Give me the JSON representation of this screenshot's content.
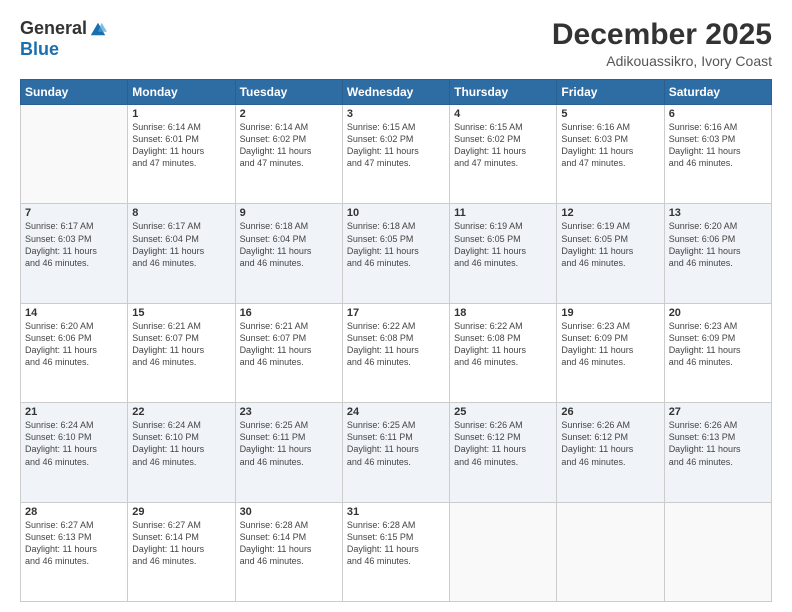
{
  "logo": {
    "general": "General",
    "blue": "Blue"
  },
  "header": {
    "month": "December 2025",
    "location": "Adikouassikro, Ivory Coast"
  },
  "weekdays": [
    "Sunday",
    "Monday",
    "Tuesday",
    "Wednesday",
    "Thursday",
    "Friday",
    "Saturday"
  ],
  "weeks": [
    [
      {
        "day": "",
        "info": ""
      },
      {
        "day": "1",
        "info": "Sunrise: 6:14 AM\nSunset: 6:01 PM\nDaylight: 11 hours\nand 47 minutes."
      },
      {
        "day": "2",
        "info": "Sunrise: 6:14 AM\nSunset: 6:02 PM\nDaylight: 11 hours\nand 47 minutes."
      },
      {
        "day": "3",
        "info": "Sunrise: 6:15 AM\nSunset: 6:02 PM\nDaylight: 11 hours\nand 47 minutes."
      },
      {
        "day": "4",
        "info": "Sunrise: 6:15 AM\nSunset: 6:02 PM\nDaylight: 11 hours\nand 47 minutes."
      },
      {
        "day": "5",
        "info": "Sunrise: 6:16 AM\nSunset: 6:03 PM\nDaylight: 11 hours\nand 47 minutes."
      },
      {
        "day": "6",
        "info": "Sunrise: 6:16 AM\nSunset: 6:03 PM\nDaylight: 11 hours\nand 46 minutes."
      }
    ],
    [
      {
        "day": "7",
        "info": "Sunrise: 6:17 AM\nSunset: 6:03 PM\nDaylight: 11 hours\nand 46 minutes."
      },
      {
        "day": "8",
        "info": "Sunrise: 6:17 AM\nSunset: 6:04 PM\nDaylight: 11 hours\nand 46 minutes."
      },
      {
        "day": "9",
        "info": "Sunrise: 6:18 AM\nSunset: 6:04 PM\nDaylight: 11 hours\nand 46 minutes."
      },
      {
        "day": "10",
        "info": "Sunrise: 6:18 AM\nSunset: 6:05 PM\nDaylight: 11 hours\nand 46 minutes."
      },
      {
        "day": "11",
        "info": "Sunrise: 6:19 AM\nSunset: 6:05 PM\nDaylight: 11 hours\nand 46 minutes."
      },
      {
        "day": "12",
        "info": "Sunrise: 6:19 AM\nSunset: 6:05 PM\nDaylight: 11 hours\nand 46 minutes."
      },
      {
        "day": "13",
        "info": "Sunrise: 6:20 AM\nSunset: 6:06 PM\nDaylight: 11 hours\nand 46 minutes."
      }
    ],
    [
      {
        "day": "14",
        "info": "Sunrise: 6:20 AM\nSunset: 6:06 PM\nDaylight: 11 hours\nand 46 minutes."
      },
      {
        "day": "15",
        "info": "Sunrise: 6:21 AM\nSunset: 6:07 PM\nDaylight: 11 hours\nand 46 minutes."
      },
      {
        "day": "16",
        "info": "Sunrise: 6:21 AM\nSunset: 6:07 PM\nDaylight: 11 hours\nand 46 minutes."
      },
      {
        "day": "17",
        "info": "Sunrise: 6:22 AM\nSunset: 6:08 PM\nDaylight: 11 hours\nand 46 minutes."
      },
      {
        "day": "18",
        "info": "Sunrise: 6:22 AM\nSunset: 6:08 PM\nDaylight: 11 hours\nand 46 minutes."
      },
      {
        "day": "19",
        "info": "Sunrise: 6:23 AM\nSunset: 6:09 PM\nDaylight: 11 hours\nand 46 minutes."
      },
      {
        "day": "20",
        "info": "Sunrise: 6:23 AM\nSunset: 6:09 PM\nDaylight: 11 hours\nand 46 minutes."
      }
    ],
    [
      {
        "day": "21",
        "info": "Sunrise: 6:24 AM\nSunset: 6:10 PM\nDaylight: 11 hours\nand 46 minutes."
      },
      {
        "day": "22",
        "info": "Sunrise: 6:24 AM\nSunset: 6:10 PM\nDaylight: 11 hours\nand 46 minutes."
      },
      {
        "day": "23",
        "info": "Sunrise: 6:25 AM\nSunset: 6:11 PM\nDaylight: 11 hours\nand 46 minutes."
      },
      {
        "day": "24",
        "info": "Sunrise: 6:25 AM\nSunset: 6:11 PM\nDaylight: 11 hours\nand 46 minutes."
      },
      {
        "day": "25",
        "info": "Sunrise: 6:26 AM\nSunset: 6:12 PM\nDaylight: 11 hours\nand 46 minutes."
      },
      {
        "day": "26",
        "info": "Sunrise: 6:26 AM\nSunset: 6:12 PM\nDaylight: 11 hours\nand 46 minutes."
      },
      {
        "day": "27",
        "info": "Sunrise: 6:26 AM\nSunset: 6:13 PM\nDaylight: 11 hours\nand 46 minutes."
      }
    ],
    [
      {
        "day": "28",
        "info": "Sunrise: 6:27 AM\nSunset: 6:13 PM\nDaylight: 11 hours\nand 46 minutes."
      },
      {
        "day": "29",
        "info": "Sunrise: 6:27 AM\nSunset: 6:14 PM\nDaylight: 11 hours\nand 46 minutes."
      },
      {
        "day": "30",
        "info": "Sunrise: 6:28 AM\nSunset: 6:14 PM\nDaylight: 11 hours\nand 46 minutes."
      },
      {
        "day": "31",
        "info": "Sunrise: 6:28 AM\nSunset: 6:15 PM\nDaylight: 11 hours\nand 46 minutes."
      },
      {
        "day": "",
        "info": ""
      },
      {
        "day": "",
        "info": ""
      },
      {
        "day": "",
        "info": ""
      }
    ]
  ]
}
